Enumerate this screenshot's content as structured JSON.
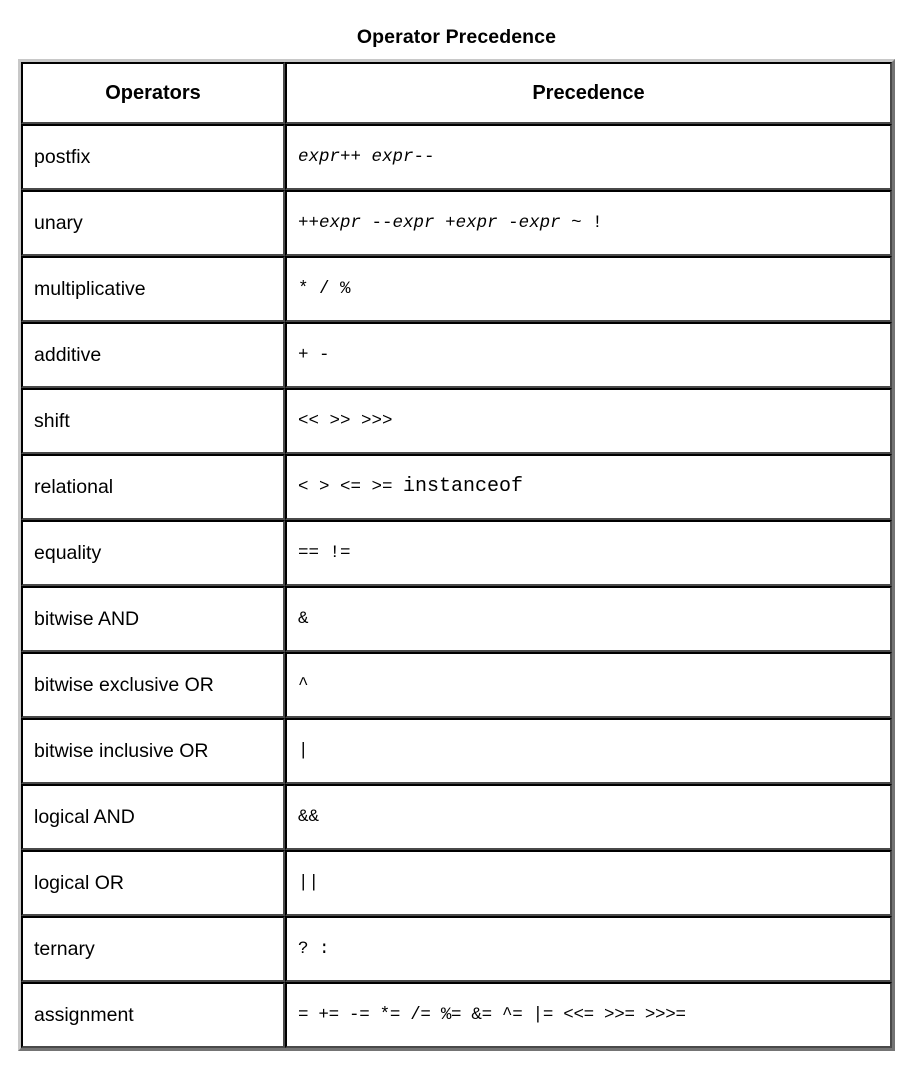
{
  "page": {
    "title": "Operator Precedence"
  },
  "table": {
    "headers": {
      "operators": "Operators",
      "precedence": "Precedence"
    },
    "rows": [
      {
        "operator": "postfix",
        "precedence": "expr++ expr--"
      },
      {
        "operator": "unary",
        "precedence": "++expr --expr +expr -expr ~ !"
      },
      {
        "operator": "multiplicative",
        "precedence": "* / %"
      },
      {
        "operator": "additive",
        "precedence": "+ -"
      },
      {
        "operator": "shift",
        "precedence": "<< >> >>>"
      },
      {
        "operator": "relational",
        "precedence": "< > <= >= instanceof"
      },
      {
        "operator": "equality",
        "precedence": "== !="
      },
      {
        "operator": "bitwise AND",
        "precedence": "&"
      },
      {
        "operator": "bitwise exclusive OR",
        "precedence": "^"
      },
      {
        "operator": "bitwise inclusive OR",
        "precedence": "|"
      },
      {
        "operator": "logical AND",
        "precedence": "&&"
      },
      {
        "operator": "logical OR",
        "precedence": "||"
      },
      {
        "operator": "ternary",
        "precedence": "? :"
      },
      {
        "operator": "assignment",
        "precedence": "= += -= *= /= %= &= ^= |= <<= >>= >>>="
      }
    ],
    "precedence_parts": [
      [
        {
          "t": "expr",
          "style": "italic"
        },
        {
          "t": "++ ",
          "style": "plain"
        },
        {
          "t": "expr",
          "style": "italic"
        },
        {
          "t": "--",
          "style": "plain"
        }
      ],
      [
        {
          "t": "++",
          "style": "plain"
        },
        {
          "t": "expr",
          "style": "italic"
        },
        {
          "t": " --",
          "style": "plain"
        },
        {
          "t": "expr",
          "style": "italic"
        },
        {
          "t": " +",
          "style": "plain"
        },
        {
          "t": "expr",
          "style": "italic"
        },
        {
          "t": " -",
          "style": "plain"
        },
        {
          "t": "expr",
          "style": "italic"
        },
        {
          "t": " ~ !",
          "style": "plain"
        }
      ],
      [
        {
          "t": "* / %",
          "style": "plain"
        }
      ],
      [
        {
          "t": "+ -",
          "style": "plain"
        }
      ],
      [
        {
          "t": "<< >> >>>",
          "style": "plain"
        }
      ],
      [
        {
          "t": "< > <= >= ",
          "style": "plain"
        },
        {
          "t": "instanceof",
          "style": "keyword"
        }
      ],
      [
        {
          "t": "== !=",
          "style": "plain"
        }
      ],
      [
        {
          "t": "&",
          "style": "plain"
        }
      ],
      [
        {
          "t": "^",
          "style": "plain"
        }
      ],
      [
        {
          "t": "|",
          "style": "plain"
        }
      ],
      [
        {
          "t": "&&",
          "style": "plain"
        }
      ],
      [
        {
          "t": "||",
          "style": "plain"
        }
      ],
      [
        {
          "t": "? :",
          "style": "plain"
        }
      ],
      [
        {
          "t": "= += -= *= /= %= &= ^= |= <<= >>= >>>=",
          "style": "plain"
        }
      ]
    ]
  },
  "colors": {
    "page_background": "#ffffff",
    "text": "#000000",
    "cell_border_dark": "#4a4a4a",
    "cell_border_light": "#c8c8c8",
    "table_frame": "#c8c8c8"
  }
}
